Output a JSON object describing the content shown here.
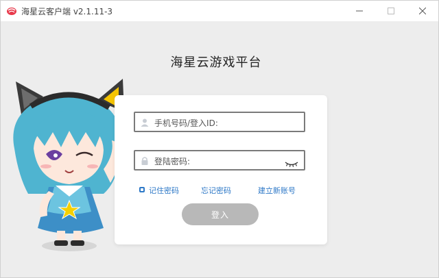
{
  "window": {
    "title": "海星云客户端 v2.1.11-3"
  },
  "heading": "海星云游戏平台",
  "login": {
    "phone_placeholder": "手机号码/登入ID:",
    "password_placeholder": "登陆密码:",
    "remember_label": "记住密码",
    "forgot_label": "忘记密码",
    "register_label": "建立新账号",
    "submit_label": "登入"
  },
  "colors": {
    "accent_link": "#2d78c7",
    "button_disabled": "#b8b8b8",
    "mascot_hair": "#4fb4d0"
  },
  "icons": {
    "app": "app-logo-icon",
    "user": "user-icon",
    "lock": "lock-icon",
    "password_toggle": "eye-closed-icon"
  }
}
